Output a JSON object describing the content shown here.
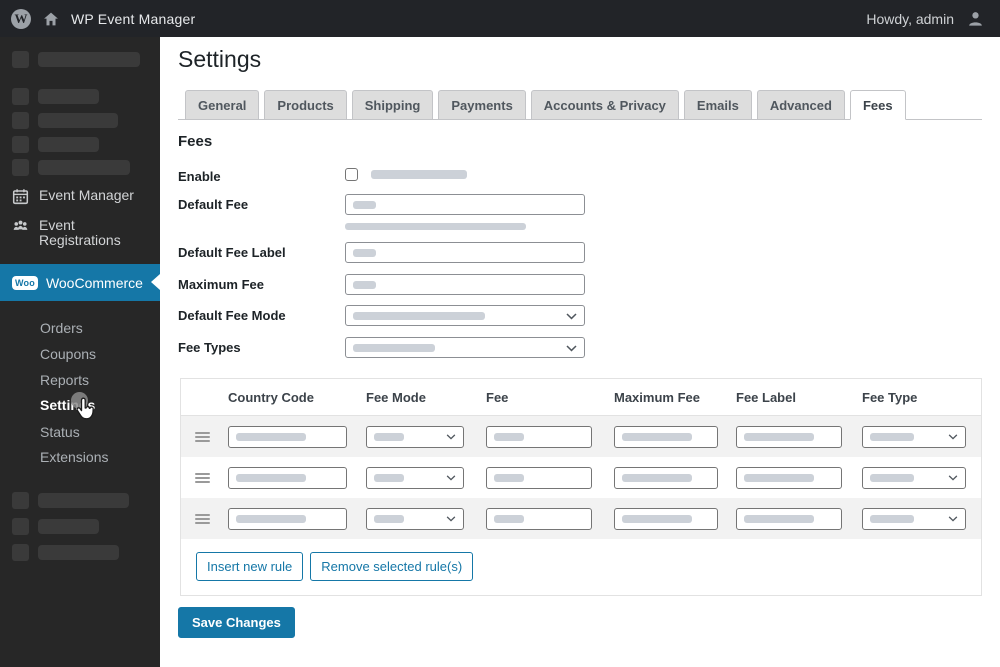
{
  "admin_bar": {
    "site_title": "WP Event Manager",
    "user_greeting": "Howdy, admin"
  },
  "sidebar": {
    "event_manager_label": "Event Manager",
    "event_registrations_label": "Event Registrations",
    "woocommerce": {
      "badge": "Woo",
      "label": "WooCommerce"
    },
    "submenu": [
      {
        "label": "Orders",
        "active": false
      },
      {
        "label": "Coupons",
        "active": false
      },
      {
        "label": "Reports",
        "active": false
      },
      {
        "label": "Settings",
        "active": true
      },
      {
        "label": "Status",
        "active": false
      },
      {
        "label": "Extensions",
        "active": false
      }
    ]
  },
  "main": {
    "page_title": "Settings",
    "tabs": [
      {
        "label": "General",
        "active": false
      },
      {
        "label": "Products",
        "active": false
      },
      {
        "label": "Shipping",
        "active": false
      },
      {
        "label": "Payments",
        "active": false
      },
      {
        "label": "Accounts & Privacy",
        "active": false
      },
      {
        "label": "Emails",
        "active": false
      },
      {
        "label": "Advanced",
        "active": false
      },
      {
        "label": "Fees",
        "active": true
      }
    ],
    "section_title": "Fees",
    "form": {
      "enable_label": "Enable",
      "default_fee_label": "Default Fee",
      "default_fee_label_label": "Default Fee Label",
      "maximum_fee_label": "Maximum Fee",
      "default_fee_mode_label": "Default Fee Mode",
      "fee_types_label": "Fee Types"
    },
    "rules_table": {
      "columns": [
        "Country Code",
        "Fee Mode",
        "Fee",
        "Maximum Fee",
        "Fee Label",
        "Fee Type"
      ],
      "row_count": 3
    },
    "actions": {
      "insert_rule": "Insert new rule",
      "remove_rule": "Remove selected rule(s)",
      "save": "Save Changes"
    }
  },
  "colors": {
    "accent_blue": "#1577a7",
    "admin_bar_bg": "#222428",
    "sidebar_bg": "#272727"
  }
}
